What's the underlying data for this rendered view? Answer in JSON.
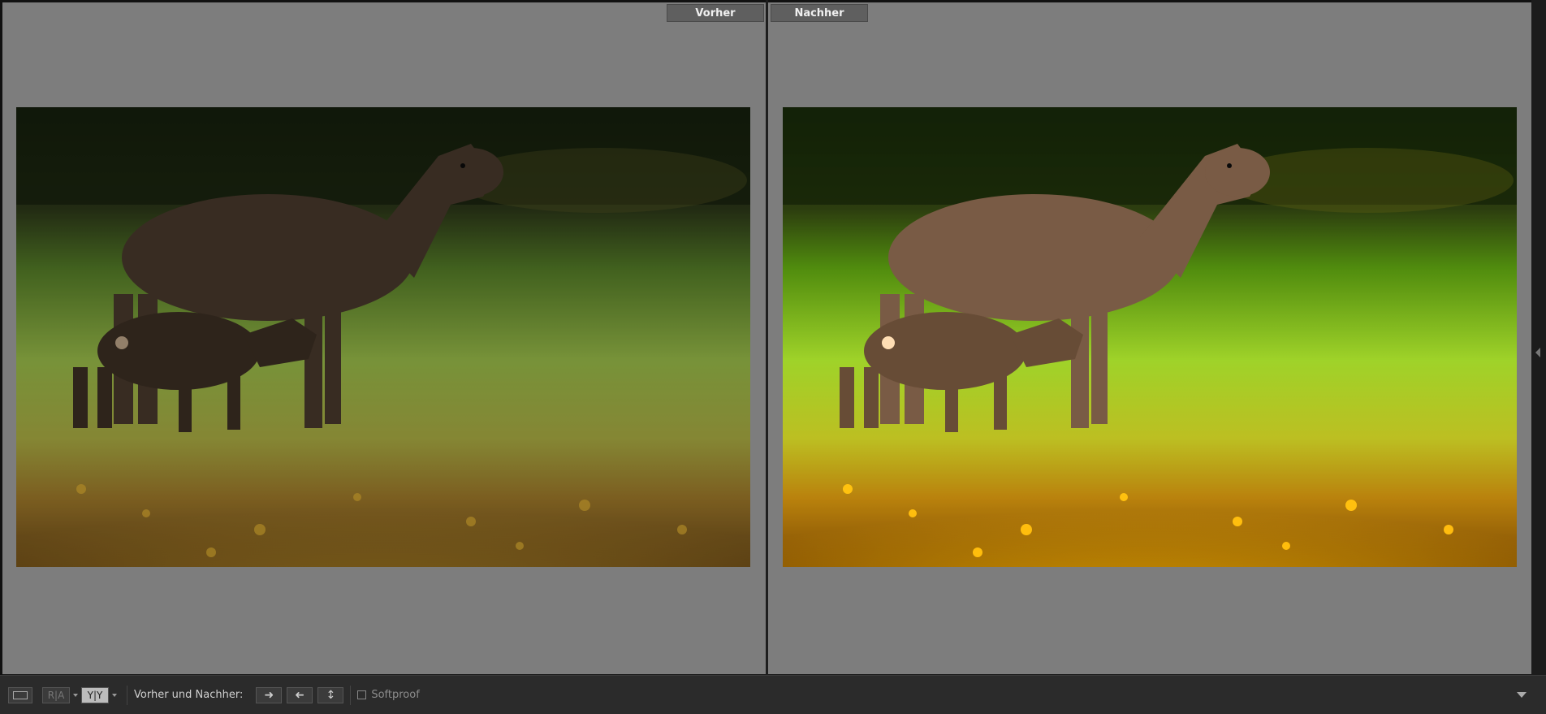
{
  "panes": {
    "before_label": "Vorher",
    "after_label": "Nachher"
  },
  "toolbar": {
    "compare_label": "Vorher und Nachher:",
    "view_modes": [
      {
        "name": "loupe-view",
        "text": ""
      },
      {
        "name": "side-by-side",
        "text": "R|A"
      },
      {
        "name": "split-view",
        "text": "Y|Y"
      }
    ],
    "softproof_label": "Softproof",
    "softproof_checked": false
  },
  "colors": {
    "pane_bg": "#7d7d7d",
    "toolbar_bg": "#2b2b2b",
    "tab_bg": "#5f5f5f"
  },
  "photo": {
    "subject": ""
  }
}
